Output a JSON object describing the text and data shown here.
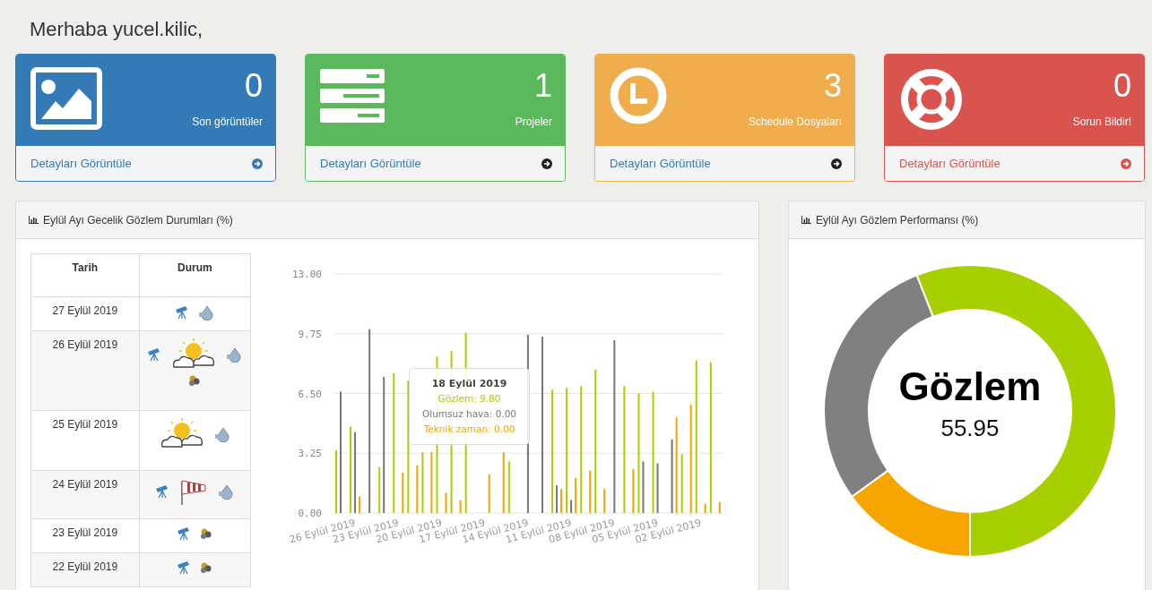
{
  "greeting": "Merhaba yucel.kilic,",
  "cards": [
    {
      "kind": "image",
      "color": "#337ab7",
      "count": "0",
      "label": "Son görüntüler",
      "link": "Detayları Görüntüle"
    },
    {
      "kind": "server",
      "color": "#5cb85c",
      "count": "1",
      "label": "Projeler",
      "link": "Detayları Görüntüle"
    },
    {
      "kind": "clock",
      "color": "#f0ad4e",
      "count": "3",
      "label": "Schedule Dosyaları",
      "link": "Detayları Görüntüle"
    },
    {
      "kind": "lifering",
      "color": "#d9534f",
      "count": "0",
      "label": "Sorun Bildir!",
      "link": "Detayları Görüntüle"
    }
  ],
  "nightly_panel": {
    "title": "Eylül Ayı Gecelik Gözlem Durumları (%)",
    "table": {
      "columns": [
        "Tarih",
        "Durum"
      ],
      "rows": [
        {
          "date": "27 Eylül 2019",
          "conditions": [
            {
              "kind": "telescope"
            },
            {
              "kind": "drop"
            }
          ]
        },
        {
          "date": "26 Eylül 2019",
          "conditions": [
            {
              "kind": "telescope"
            },
            {
              "kind": "suncloud"
            },
            {
              "kind": "drop"
            },
            {
              "kind": "cluster"
            }
          ]
        },
        {
          "date": "25 Eylül 2019",
          "conditions": [
            {
              "kind": "suncloud"
            },
            {
              "kind": "drop"
            }
          ]
        },
        {
          "date": "24 Eylül 2019",
          "conditions": [
            {
              "kind": "telescope"
            },
            {
              "kind": "windsock"
            },
            {
              "kind": "drop"
            }
          ]
        },
        {
          "date": "23 Eylül 2019",
          "conditions": [
            {
              "kind": "telescope"
            },
            {
              "kind": "cluster"
            }
          ]
        },
        {
          "date": "22 Eylül 2019",
          "conditions": [
            {
              "kind": "telescope"
            },
            {
              "kind": "cluster"
            }
          ]
        }
      ]
    },
    "chart_data": {
      "type": "bar",
      "grid": true,
      "ylim": [
        0,
        13
      ],
      "yticks": [
        {
          "value": 0,
          "label": "0.00"
        },
        {
          "value": 3.25,
          "label": "3.25"
        },
        {
          "value": 6.5,
          "label": "6.50"
        },
        {
          "value": 9.75,
          "label": "9.75"
        },
        {
          "value": 13,
          "label": "13.00"
        }
      ],
      "categories": [
        null,
        "26 Eylül 2019",
        null,
        null,
        "23 Eylül 2019",
        null,
        null,
        "20 Eylül 2019",
        null,
        null,
        "17 Eylül 2019",
        null,
        null,
        "14 Eylül 2019",
        null,
        null,
        "11 Eylül 2019",
        null,
        null,
        "08 Eylül 2019",
        null,
        null,
        "05 Eylül 2019",
        null,
        null,
        "02 Eylül 2019",
        null
      ],
      "series": [
        {
          "color": "#a8d000",
          "values": [
            3.4,
            4.7,
            0,
            2.5,
            7.6,
            7.2,
            3.3,
            8.5,
            8.8,
            9.8,
            null,
            null,
            2.8,
            0,
            0,
            6.7,
            6.8,
            6.9,
            7.8,
            0,
            6.9,
            6.5,
            6.6,
            0,
            3.2,
            8.3,
            8.2
          ]
        },
        {
          "color": "#777777",
          "values": [
            6.6,
            4.4,
            10.0,
            7.4,
            0,
            0,
            0,
            0,
            0,
            0,
            0,
            0,
            null,
            9.7,
            9.6,
            1.5,
            0.7,
            0,
            0,
            9.4,
            0,
            2.8,
            2.7,
            4.0,
            0,
            0,
            0
          ]
        },
        {
          "color": "#f5a300",
          "values": [
            0,
            0.9,
            0,
            0,
            2.2,
            2.6,
            3.3,
            1.1,
            0.7,
            0,
            2.1,
            3.3,
            0,
            0,
            0,
            1.3,
            1.9,
            2.3,
            1.3,
            0,
            2.4,
            0,
            0,
            5.2,
            5.9,
            0.5,
            0.6
          ]
        }
      ]
    },
    "tooltip": {
      "title": "18 Eylül 2019",
      "lines": [
        {
          "text": "Gözlem: 9.80",
          "color": "#a8d000"
        },
        {
          "text": "Olumsuz hava: 0.00",
          "color": "#777777"
        },
        {
          "text": "Teknik zaman: 0.00",
          "color": "#f5a300"
        }
      ]
    }
  },
  "performance_panel": {
    "title": "Eylül Ayı Gözlem Performansı (%)",
    "chart_data": {
      "type": "donut",
      "values": [
        55.95,
        15.0,
        29.05
      ],
      "colors": [
        "#a8d000",
        "#f7a600",
        "#808080"
      ]
    },
    "center_label": "Gözlem",
    "center_value": "55.95"
  }
}
